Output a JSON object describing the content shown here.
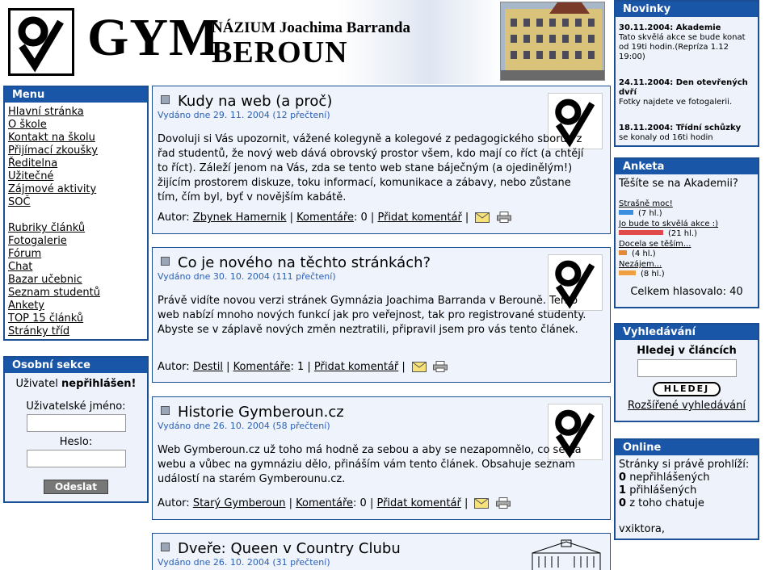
{
  "header": {
    "big": "GYM",
    "sub": "NÁZIUM Joachima Barranda",
    "city": "BEROUN"
  },
  "menu": {
    "title": "Menu",
    "items": [
      "Hlavní stránka",
      "O škole",
      "Kontakt na školu",
      "Přijímací zkoušky",
      "Ředitelna",
      "Užitečné",
      "Zájmové aktivity",
      "SOČ",
      "",
      "Rubriky článků",
      "Fotogalerie",
      "Fórum",
      "Chat",
      "Bazar učebnic",
      "Seznam studentů",
      "Ankety",
      "TOP 15 článků",
      "Stránky tříd"
    ]
  },
  "osobni": {
    "title": "Osobní sekce",
    "user_prefix": "Uživatel",
    "user_state": "nepřihlášen!",
    "username_label": "Uživatelské jméno:",
    "password_label": "Heslo:",
    "submit": "Odeslat"
  },
  "articles": [
    {
      "title": "Kudy na web (a proč)",
      "meta": "Vydáno dne 29. 11. 2004 (12 přečtení)",
      "body": "Dovoluji si Vás upozornit, vážené kolegyně a kolegové z pedagogického sboru i z řad studentů, že nový web dává obrovský prostor všem, kdo mají co říct (a chtějí to říct). Záleží jenom na Vás, zda se tento web stane báječným (a ojedinělým!) žijícím prostorem diskuze, toku informací, komunikace a zábavy, nebo zůstane tím, čím byl, byť v novějším kabátě.",
      "author_label": "Autor:",
      "author": "Zbynek Hamernik",
      "comments_label": "Komentáře",
      "comments": ": 0",
      "add": "Přidat komentář"
    },
    {
      "title": "Co je nového na těchto stránkách?",
      "meta": "Vydáno dne 30. 10. 2004 (111 přečtení)",
      "body": "Právě vidíte novou verzi stránek Gymnázia Joachima Barranda v Berouně. Tento web nabízí mnoho nových funkcí jak pro veřejnost, tak pro registrované studenty. Abyste se v záplavě nových změn neztratili, připravil jsem pro vás tento článek.",
      "author_label": "Autor:",
      "author": "Destil",
      "comments_label": "Komentáře",
      "comments": ": 1",
      "add": "Přidat komentář"
    },
    {
      "title": "Historie Gymberoun.cz",
      "meta": "Vydáno dne 26. 10. 2004 (58 přečtení)",
      "body": "Web Gymberoun.cz už toho má hodně za sebou a aby se nezapomnělo, co se na webu a vůbec na gymnáziu dělo, přináším vám tento článek. Obsahuje seznam událostí na starém Gymberounu.cz.",
      "author_label": "Autor:",
      "author": "Starý Gymberoun",
      "comments_label": "Komentáře",
      "comments": ": 0",
      "add": "Přidat komentář"
    },
    {
      "title": "Dveře: Queen v Country Clubu",
      "meta": "Vydáno dne 26. 10. 2004 (31 přečtení)"
    }
  ],
  "novinky": {
    "title": "Novinky",
    "items": [
      {
        "date": "30.11.2004:",
        "head": "Akademie",
        "text": "Tato skvělá akce se bude konat od 19ti hodin.(Repríza 1.12 19:00)"
      },
      {
        "date": "24.11.2004:",
        "head": "Den otevřených dvří",
        "text": "Fotky najdete ve fotogalerii."
      },
      {
        "date": "18.11.2004:",
        "head": "Třídní schůzky",
        "text": "se konaly od 16ti hodin"
      }
    ]
  },
  "anketa": {
    "title": "Anketa",
    "question": "Těšíte se na Akademii?",
    "options": [
      {
        "label": "Strašně moc!",
        "votes": "(7 hl.)",
        "count": 7,
        "color": "#3a8ee0"
      },
      {
        "label": "Jo bude to skvělá akce :)",
        "votes": "(21 hl.)",
        "count": 21,
        "color": "#e04a4a"
      },
      {
        "label": "Docela se těším...",
        "votes": "(4 hl.)",
        "count": 4,
        "color": "#e08a3a"
      },
      {
        "label": "Nezájem...",
        "votes": "(8 hl.)",
        "count": 8,
        "color": "#f0a040"
      }
    ],
    "total": "Celkem hlasovalo: 40"
  },
  "vyhled": {
    "title": "Vyhledávání",
    "label": "Hledej v článcích",
    "button": "HLEDEJ",
    "advanced": "Rozšířené vyhledávání"
  },
  "online": {
    "title": "Online",
    "intro": "Stránky si právě prohlíží:",
    "rows": [
      {
        "n": "0",
        "t": "nepřihlášených"
      },
      {
        "n": "1",
        "t": "přihlášených"
      },
      {
        "n": "0",
        "t": "z toho chatuje"
      }
    ],
    "user": "vxiktora,"
  }
}
